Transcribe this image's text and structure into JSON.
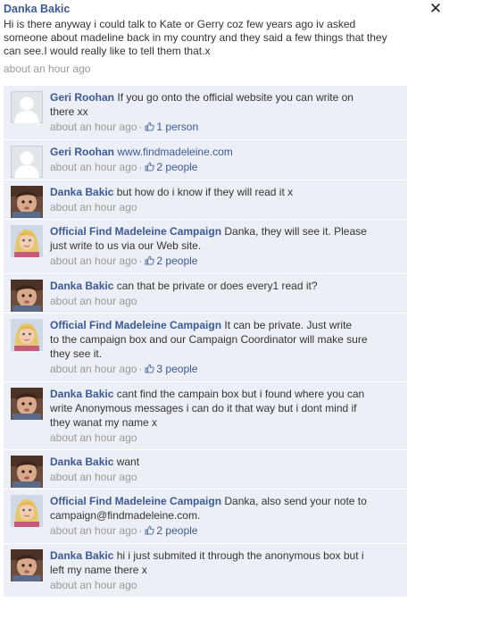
{
  "post": {
    "author": "Danka Bakic",
    "text_lines": [
      "Hi is there anyway i could talk to Kate or Gerry coz few years ago iv asked",
      "someone about madeline back in my country and they said a few things that they",
      "can see.I would really like to tell them that.x"
    ],
    "time": "about an hour ago"
  },
  "icons": {
    "close": "close-icon",
    "like": "thumbs-up-icon"
  },
  "colors": {
    "link": "#3b5998",
    "comment_bg": "#eceff5",
    "meta": "#999999"
  },
  "comments": [
    {
      "author": "Geri Roohan",
      "avatar": "default-silhouette",
      "text_lines": [
        "If you go onto the official website you can write on",
        "there xx"
      ],
      "time": "about an hour ago",
      "likes": "1 person"
    },
    {
      "author": "Geri Roohan",
      "avatar": "default-silhouette",
      "text_lines": [
        "www.findmadeleine.com"
      ],
      "is_link": true,
      "time": "about an hour ago",
      "likes": "2 people"
    },
    {
      "author": "Danka Bakic",
      "avatar": "child-photo",
      "text_lines": [
        "but how do i know if they will read it x"
      ],
      "time": "about an hour ago",
      "likes": ""
    },
    {
      "author": "Official Find Madeleine Campaign",
      "avatar": "madeleine-photo",
      "text_lines": [
        "Danka, they will see it. Please",
        "just write to us via our Web site."
      ],
      "time": "about an hour ago",
      "likes": "2 people"
    },
    {
      "author": "Danka Bakic",
      "avatar": "child-photo",
      "text_lines": [
        "can that be private or does every1 read it?"
      ],
      "time": "about an hour ago",
      "likes": ""
    },
    {
      "author": "Official Find Madeleine Campaign",
      "avatar": "madeleine-photo",
      "text_lines": [
        "It can be private. Just write",
        "to the campaign box and our Campaign Coordinator will make sure",
        "they see it."
      ],
      "time": "about an hour ago",
      "likes": "3 people"
    },
    {
      "author": "Danka Bakic",
      "avatar": "child-photo",
      "text_lines": [
        "cant find the campain box but i found where you can",
        "write Anonymous messages i can do it that way but i dont mind if",
        "they wanat my name x"
      ],
      "time": "about an hour ago",
      "likes": ""
    },
    {
      "author": "Danka Bakic",
      "avatar": "child-photo",
      "text_lines": [
        "want"
      ],
      "time": "about an hour ago",
      "likes": ""
    },
    {
      "author": "Official Find Madeleine Campaign",
      "avatar": "madeleine-photo",
      "text_lines": [
        "Danka, also send your note to",
        "campaign@findmadeleine.com."
      ],
      "time": "about an hour ago",
      "likes": "2 people"
    },
    {
      "author": "Danka Bakic",
      "avatar": "child-photo",
      "text_lines": [
        "hi i just submited it through the anonymous box but i",
        "left my name there x"
      ],
      "time": "about an hour ago",
      "likes": ""
    }
  ]
}
